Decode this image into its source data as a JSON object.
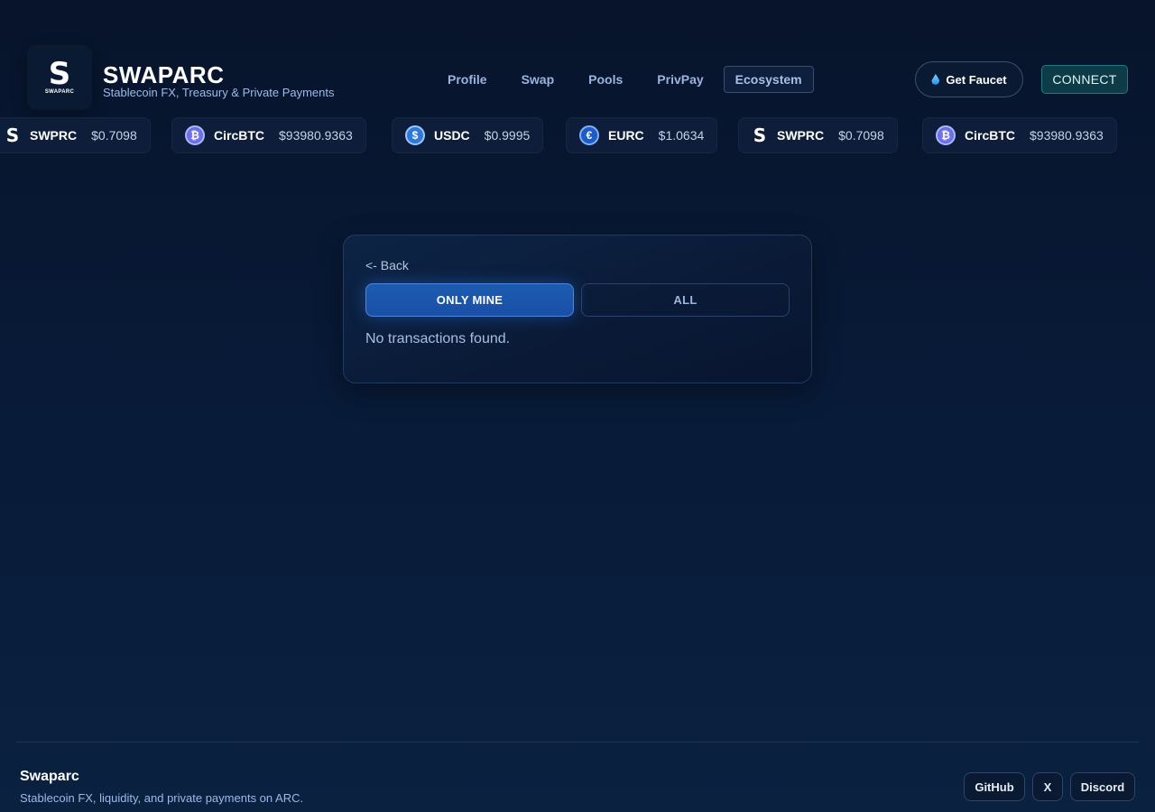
{
  "brand": {
    "logo_letter": "S",
    "logo_sub": "SWAPARC",
    "title": "SWAPARC",
    "subtitle": "Stablecoin FX, Treasury & Private Payments"
  },
  "nav": {
    "items": [
      {
        "label": "Profile"
      },
      {
        "label": "Swap"
      },
      {
        "label": "Pools"
      },
      {
        "label": "PrivPay"
      },
      {
        "label": "Ecosystem",
        "active": true
      }
    ]
  },
  "header_actions": {
    "faucet_label": "Get Faucet",
    "connect_label": "CONNECT"
  },
  "ticker": [
    {
      "symbol": "SWPRC",
      "price": "$0.7098",
      "icon": "swprc-icon",
      "glyph": "S"
    },
    {
      "symbol": "CircBTC",
      "price": "$93980.9363",
      "icon": "bitcoin-icon",
      "glyph": "₿"
    },
    {
      "symbol": "USDC",
      "price": "$0.9995",
      "icon": "usdc-icon",
      "glyph": "$"
    },
    {
      "symbol": "EURC",
      "price": "$1.0634",
      "icon": "eurc-icon",
      "glyph": "€"
    },
    {
      "symbol": "SWPRC",
      "price": "$0.7098",
      "icon": "swprc-icon",
      "glyph": "S"
    },
    {
      "symbol": "CircBTC",
      "price": "$93980.9363",
      "icon": "bitcoin-icon",
      "glyph": "₿"
    }
  ],
  "card": {
    "back_label": "<- Back",
    "filter_mine": "ONLY MINE",
    "filter_all": "ALL",
    "empty_message": "No transactions found."
  },
  "footer": {
    "title": "Swaparc",
    "subtitle": "Stablecoin FX, liquidity, and private payments on ARC.",
    "links": [
      "GitHub",
      "X",
      "Discord"
    ]
  },
  "colors": {
    "accent": "#1c5bb0",
    "connect_bg": "#0d3b48",
    "background": "#07142b"
  }
}
